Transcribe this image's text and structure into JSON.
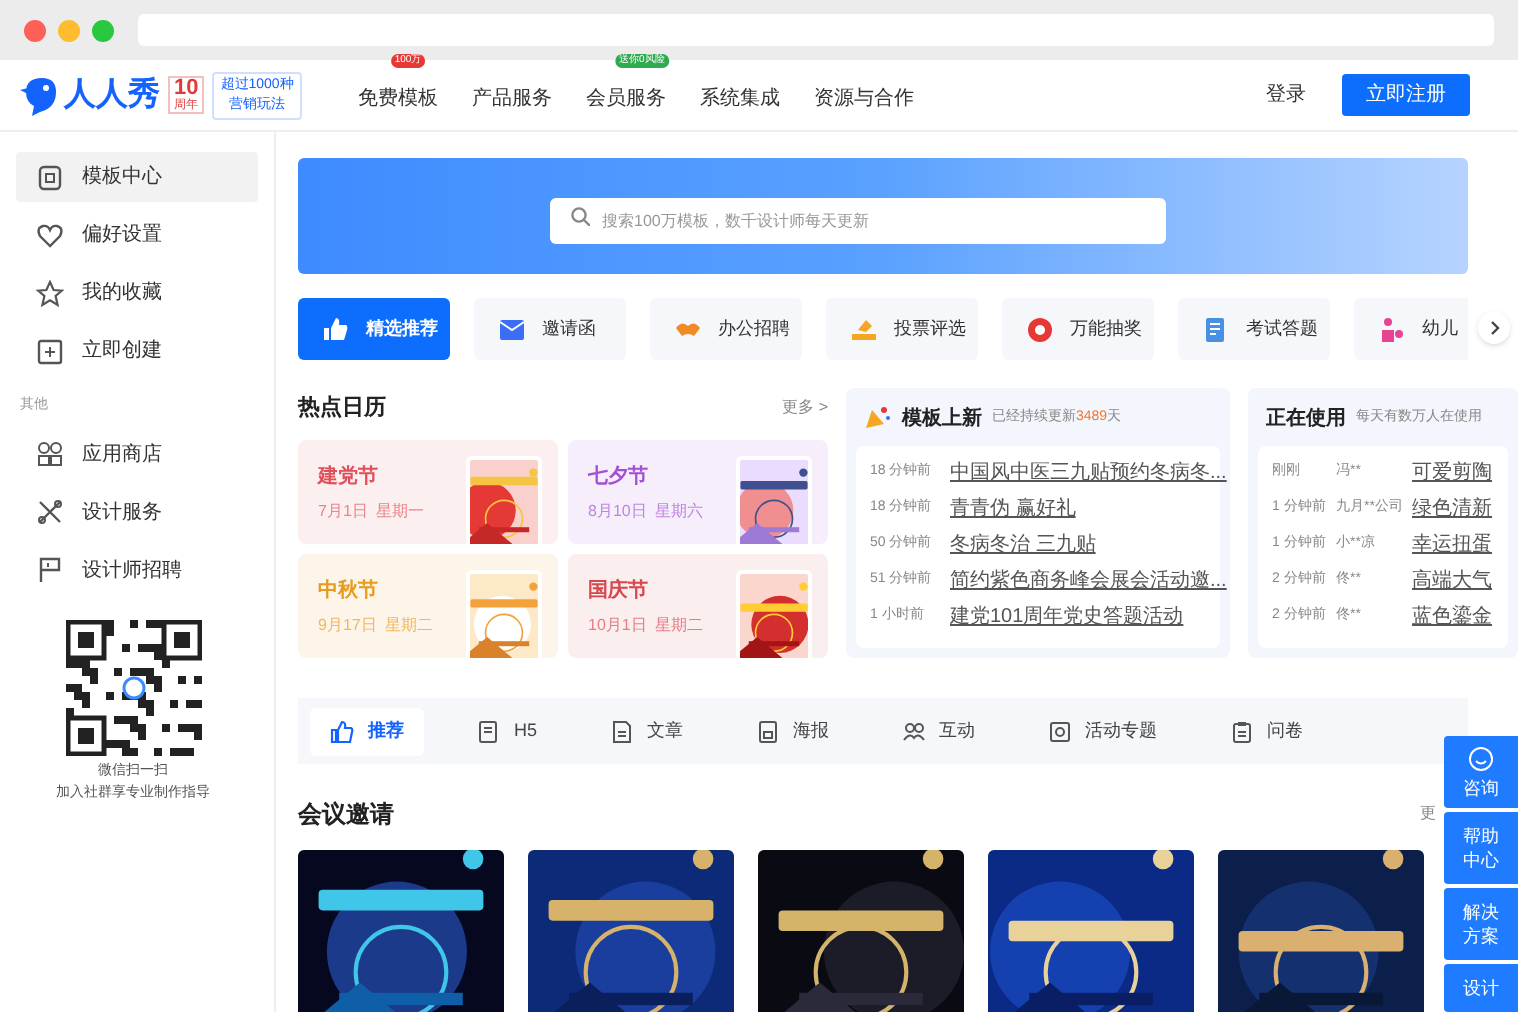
{
  "header": {
    "logo": "人人秀",
    "anniversary": {
      "number": "10",
      "label": "周年"
    },
    "promo": [
      "超过1000种",
      "营销玩法"
    ],
    "nav": [
      {
        "label": "免费模板",
        "badge": "100万",
        "color": "#e53935"
      },
      {
        "label": "产品服务"
      },
      {
        "label": "会员服务",
        "badge": "送你0风险",
        "color": "#2eaa4f"
      },
      {
        "label": "系统集成"
      },
      {
        "label": "资源与合作"
      }
    ],
    "login": "登录",
    "register": "立即注册"
  },
  "sidebar": {
    "items": [
      {
        "label": "模板中心",
        "selected": true
      },
      {
        "label": "偏好设置",
        "selected": false
      },
      {
        "label": "我的收藏",
        "selected": false
      },
      {
        "label": "立即创建",
        "selected": false
      }
    ],
    "section": "其他",
    "more_items": [
      {
        "label": "应用商店",
        "selected": false
      },
      {
        "label": "设计服务",
        "selected": false
      },
      {
        "label": "设计师招聘",
        "selected": false
      }
    ],
    "qr_caption": [
      "微信扫一扫",
      "加入社群享专业制作指导"
    ]
  },
  "search": {
    "placeholder": "搜索100万模板，数千设计师每天更新"
  },
  "categories": [
    {
      "label": "精选推荐",
      "selected": true,
      "color": "#ffffff"
    },
    {
      "label": "邀请函",
      "selected": false,
      "color": "#3b6ef5"
    },
    {
      "label": "办公招聘",
      "selected": false,
      "color": "#f08a24"
    },
    {
      "label": "投票评选",
      "selected": false,
      "color": "#f5a623"
    },
    {
      "label": "万能抽奖",
      "selected": false,
      "color": "#e53935"
    },
    {
      "label": "考试答题",
      "selected": false,
      "color": "#4a90e2"
    },
    {
      "label": "幼儿",
      "selected": false,
      "color": "#e84393"
    }
  ],
  "calendar": {
    "title": "热点日历",
    "more": "更多 >",
    "cards": [
      {
        "name": "建党节",
        "date": "7月1日",
        "weekday": "星期一",
        "color": "#e0505a"
      },
      {
        "name": "七夕节",
        "date": "8月10日",
        "weekday": "星期六",
        "color": "#a44fd6"
      },
      {
        "name": "中秋节",
        "date": "9月17日",
        "weekday": "星期二",
        "color": "#e89a1c"
      },
      {
        "name": "国庆节",
        "date": "10月1日",
        "weekday": "星期二",
        "color": "#d9464e"
      }
    ]
  },
  "new_templates": {
    "title": "模板上新",
    "subtitle": "已经持续更新",
    "count": "3489",
    "unit": "天",
    "rows": [
      {
        "time": "18 分钟前",
        "title": "中国风中医三九贴预约冬病冬..."
      },
      {
        "time": "18 分钟前",
        "title": "青青伪 赢好礼"
      },
      {
        "time": "50 分钟前",
        "title": "冬病冬治 三九贴"
      },
      {
        "time": "51 分钟前",
        "title": "简约紫色商务峰会展会活动邀..."
      },
      {
        "time": "1 小时前",
        "title": "建党101周年党史答题活动"
      }
    ]
  },
  "in_use": {
    "title": "正在使用",
    "subtitle": "每天有数万人在使用",
    "rows": [
      {
        "time": "刚刚",
        "user": "冯**",
        "title": "可爱剪陶"
      },
      {
        "time": "1 分钟前",
        "user": "九月**公司",
        "title": "绿色清新"
      },
      {
        "time": "1 分钟前",
        "user": "小**凉",
        "title": "幸运扭蛋"
      },
      {
        "time": "2 分钟前",
        "user": "佟**",
        "title": "高端大气"
      },
      {
        "time": "2 分钟前",
        "user": "佟**",
        "title": "蓝色鎏金"
      }
    ]
  },
  "tabs": [
    {
      "label": "推荐",
      "selected": true
    },
    {
      "label": "H5",
      "selected": false
    },
    {
      "label": "文章",
      "selected": false
    },
    {
      "label": "海报",
      "selected": false
    },
    {
      "label": "互动",
      "selected": false
    },
    {
      "label": "活动专题",
      "selected": false
    },
    {
      "label": "问卷",
      "selected": false
    }
  ],
  "section": {
    "title": "会议邀请",
    "more": "更"
  },
  "float_buttons": [
    {
      "label": "咨询",
      "kind": "icon"
    },
    {
      "label": "帮助中心",
      "kind": "text"
    },
    {
      "label": "解决方案",
      "kind": "text"
    },
    {
      "label": "设计",
      "kind": "text"
    }
  ]
}
